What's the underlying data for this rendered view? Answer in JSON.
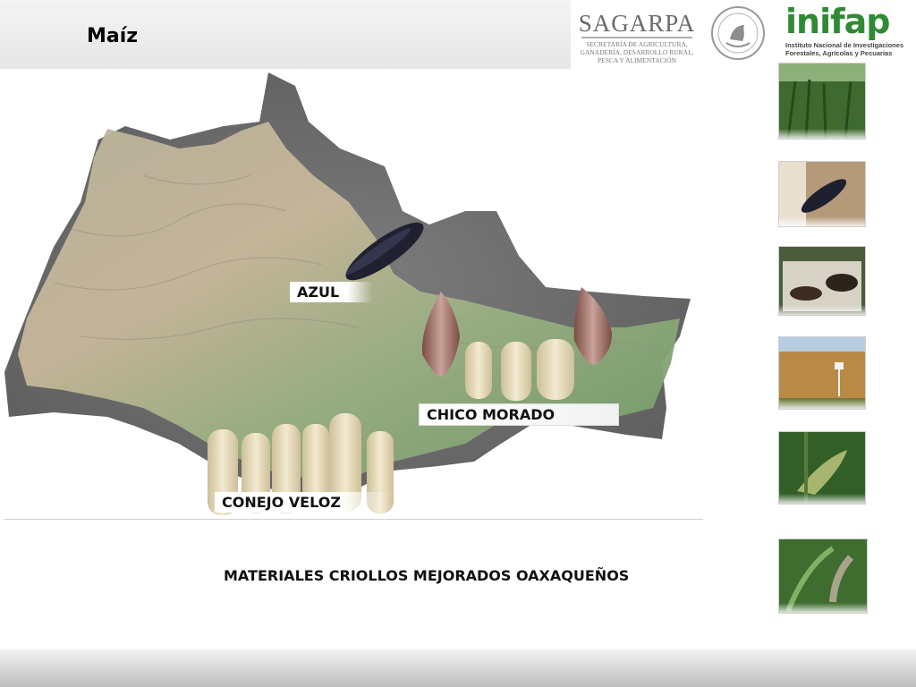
{
  "slide": {
    "title": "Maíz",
    "caption": "MATERIALES CRIOLLOS MEJORADOS OAXAQUEÑOS"
  },
  "logos": {
    "sagarpa": {
      "name": "SAGARPA",
      "subtitle_lines": [
        "SECRETARÍA DE AGRICULTURA,",
        "GANADERÍA, DESARROLLO RURAL,",
        "PESCA Y ALIMENTACIÓN"
      ]
    },
    "inifap": {
      "name": "inifap",
      "subtitle_lines": [
        "Instituto Nacional de Investigaciones",
        "Forestales, Agrícolas y Pecuarias"
      ]
    }
  },
  "map": {
    "labels": {
      "azul": "AZUL",
      "chico_morado": "CHICO MORADO",
      "conejo_veloz": "CONEJO VELOZ"
    }
  },
  "thumbnails": [
    {
      "name": "maize-field"
    },
    {
      "name": "blue-corn-ear"
    },
    {
      "name": "grain-samples"
    },
    {
      "name": "dry-maize-plot"
    },
    {
      "name": "maize-ear-on-plant"
    },
    {
      "name": "maize-leaves"
    }
  ],
  "colors": {
    "title_band": "#ebebeb",
    "inifap_green": "#2f8a34",
    "inifap_accent": "#e0a400",
    "map_relief": "#6e6e6e",
    "map_green": "#7fa06a"
  }
}
